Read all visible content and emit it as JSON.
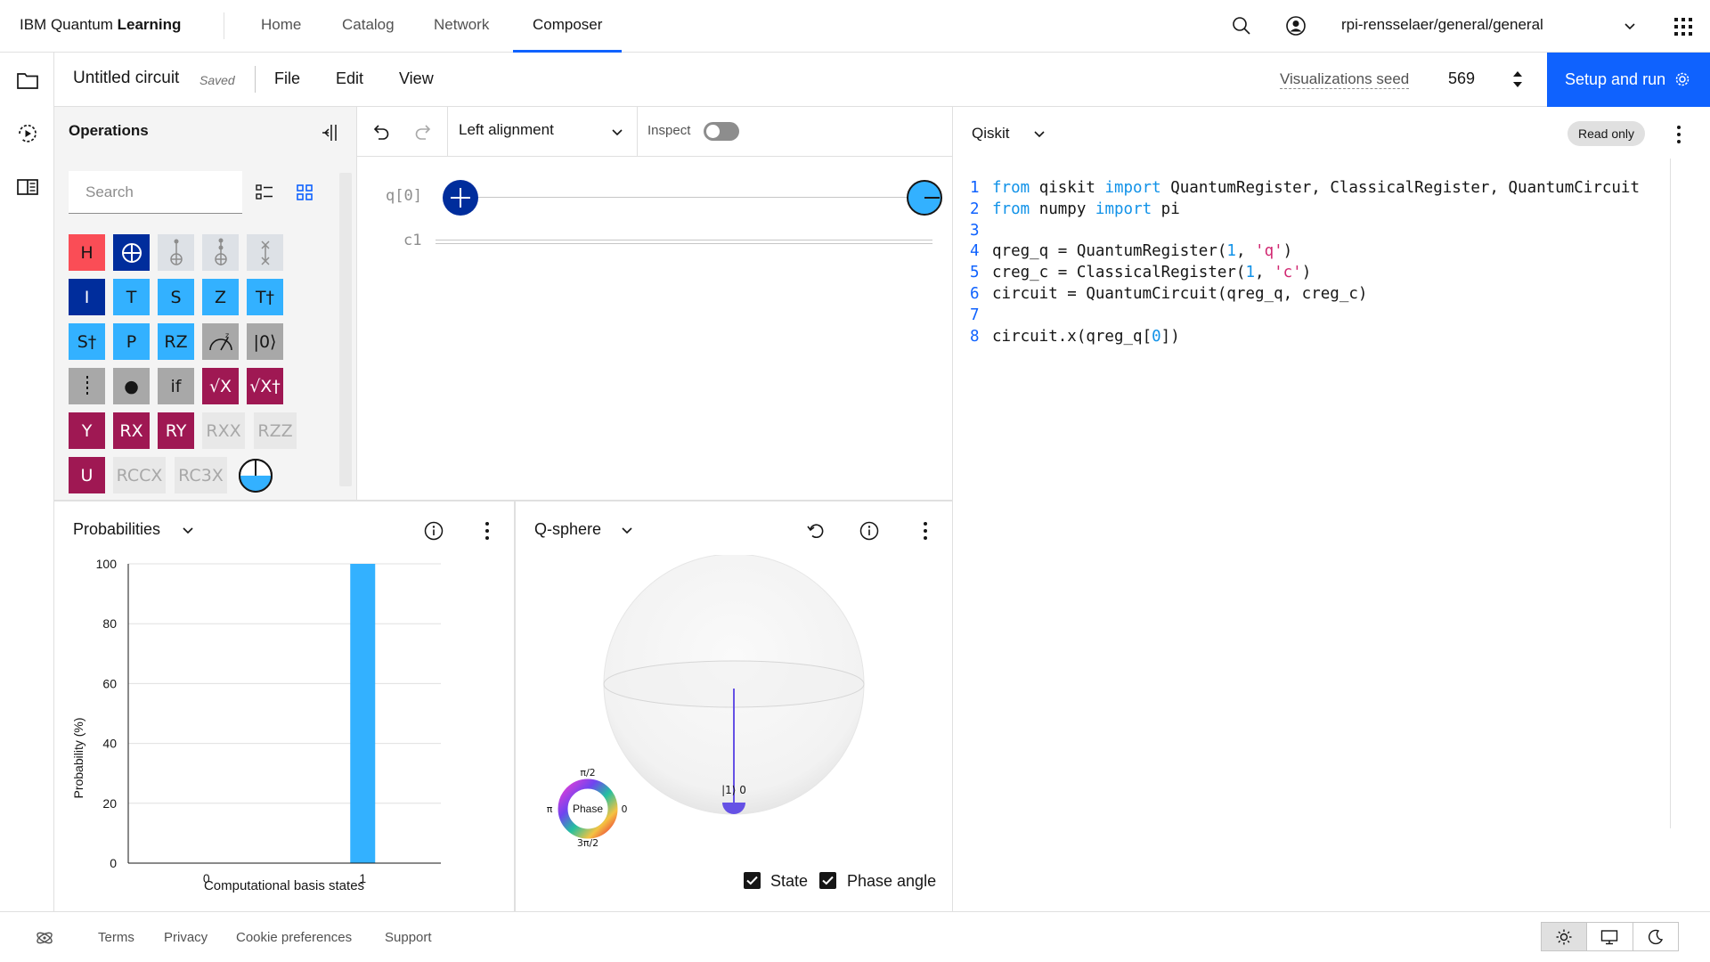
{
  "nav": {
    "brand_prefix": "IBM Quantum",
    "brand_suffix": "Learning",
    "links": [
      "Home",
      "Catalog",
      "Network",
      "Composer"
    ],
    "active_link": "Composer",
    "workspace": "rpi-rensselaer/general/general"
  },
  "circuit_bar": {
    "title": "Untitled circuit",
    "saved": "Saved",
    "menus": [
      "File",
      "Edit",
      "View"
    ],
    "seed_label": "Visualizations seed",
    "seed_value": "569",
    "run_label": "Setup and run"
  },
  "operations": {
    "title": "Operations",
    "search_placeholder": "Search",
    "gates": [
      [
        "H",
        "⊕",
        "",
        "",
        ""
      ],
      [
        "I",
        "T",
        "S",
        "Z",
        "T†"
      ],
      [
        "S†",
        "P",
        "RZ",
        "",
        "|0⟩"
      ],
      [
        "",
        "●",
        "if",
        "√X",
        "√X†"
      ],
      [
        "Y",
        "RX",
        "RY",
        "RXX",
        "RZZ"
      ],
      [
        "U",
        "RCCX",
        "RC3X",
        ""
      ]
    ]
  },
  "canvas": {
    "alignment": "Left alignment",
    "inspect_label": "Inspect",
    "qubit_label": "q[0]",
    "classical_label": "c1"
  },
  "code": {
    "language": "Qiskit",
    "readonly": "Read only",
    "lines": [
      "from qiskit import QuantumRegister, ClassicalRegister, QuantumCircuit",
      "from numpy import pi",
      "",
      "qreg_q = QuantumRegister(1, 'q')",
      "creg_c = ClassicalRegister(1, 'c')",
      "circuit = QuantumCircuit(qreg_q, creg_c)",
      "",
      "circuit.x(qreg_q[0])"
    ]
  },
  "probabilities": {
    "title": "Probabilities",
    "chart_data": {
      "type": "bar",
      "categories": [
        "0",
        "1"
      ],
      "values": [
        0,
        100
      ],
      "xlabel": "Computational basis states",
      "ylabel": "Probability (%)",
      "ylim": [
        0,
        100
      ],
      "yticks": [
        "0",
        "20",
        "40",
        "60",
        "80",
        "100"
      ],
      "color": "#33b1ff"
    }
  },
  "qsphere": {
    "title": "Q-sphere",
    "state_label": "|1⟩ 0",
    "phase_label": "Phase",
    "phase_top": "π/2",
    "phase_left": "π",
    "phase_right": "0",
    "phase_bottom": "3π/2",
    "state_checkbox": "State",
    "phase_checkbox": "Phase angle"
  },
  "footer": {
    "links": [
      "Terms",
      "Privacy",
      "Cookie preferences",
      "Support"
    ]
  },
  "colors": {
    "accent": "#0f62fe",
    "bar": "#33b1ff",
    "state_node": "#6551e5"
  }
}
